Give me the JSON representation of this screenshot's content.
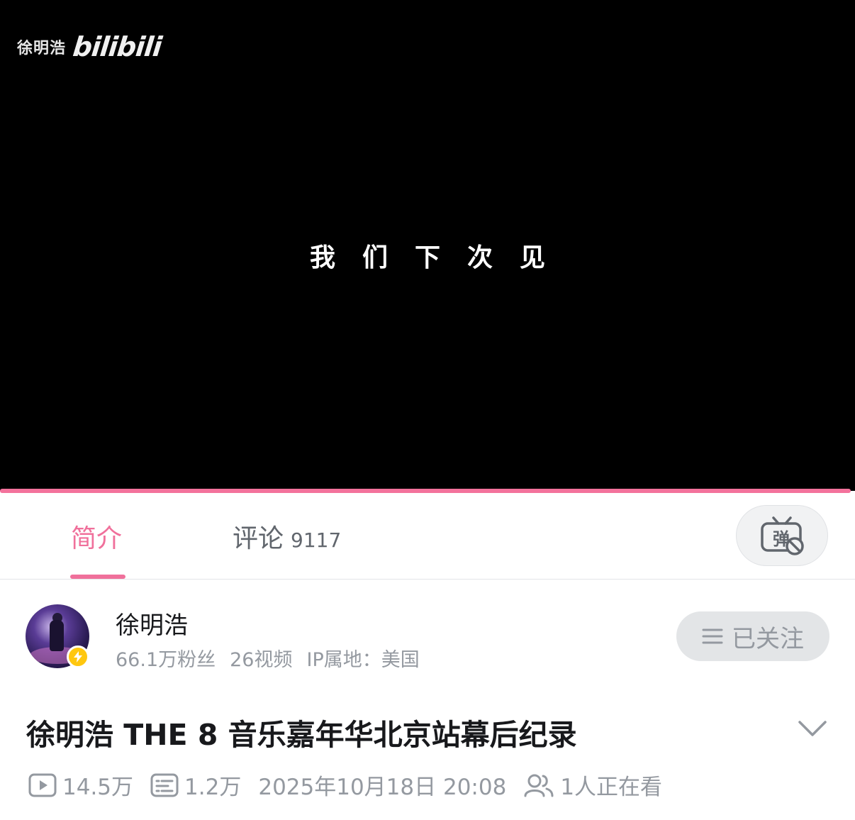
{
  "player": {
    "watermark_name": "徐明浩",
    "watermark_logo": "bilibili",
    "subtitle": "我们下次见",
    "progress": 0.995
  },
  "tabs": {
    "intro_label": "简介",
    "comments_label": "评论",
    "comments_count": "9117",
    "danmaku_icon": "danmaku-off-icon"
  },
  "uploader": {
    "name": "徐明浩",
    "fans": "66.1万粉丝",
    "videos": "26视频",
    "ip": "IP属地：美国",
    "follow_label": "已关注"
  },
  "video": {
    "title": "徐明浩 THE 8 音乐嘉年华北京站幕后纪录",
    "views": "14.5万",
    "danmaku": "1.2万",
    "date": "2025年10月18日 20:08",
    "watching": "1人正在看"
  },
  "colors": {
    "accent": "#f0709b",
    "progress": "#f3729c",
    "muted": "#9499a0",
    "badge": "#ffc70f"
  }
}
